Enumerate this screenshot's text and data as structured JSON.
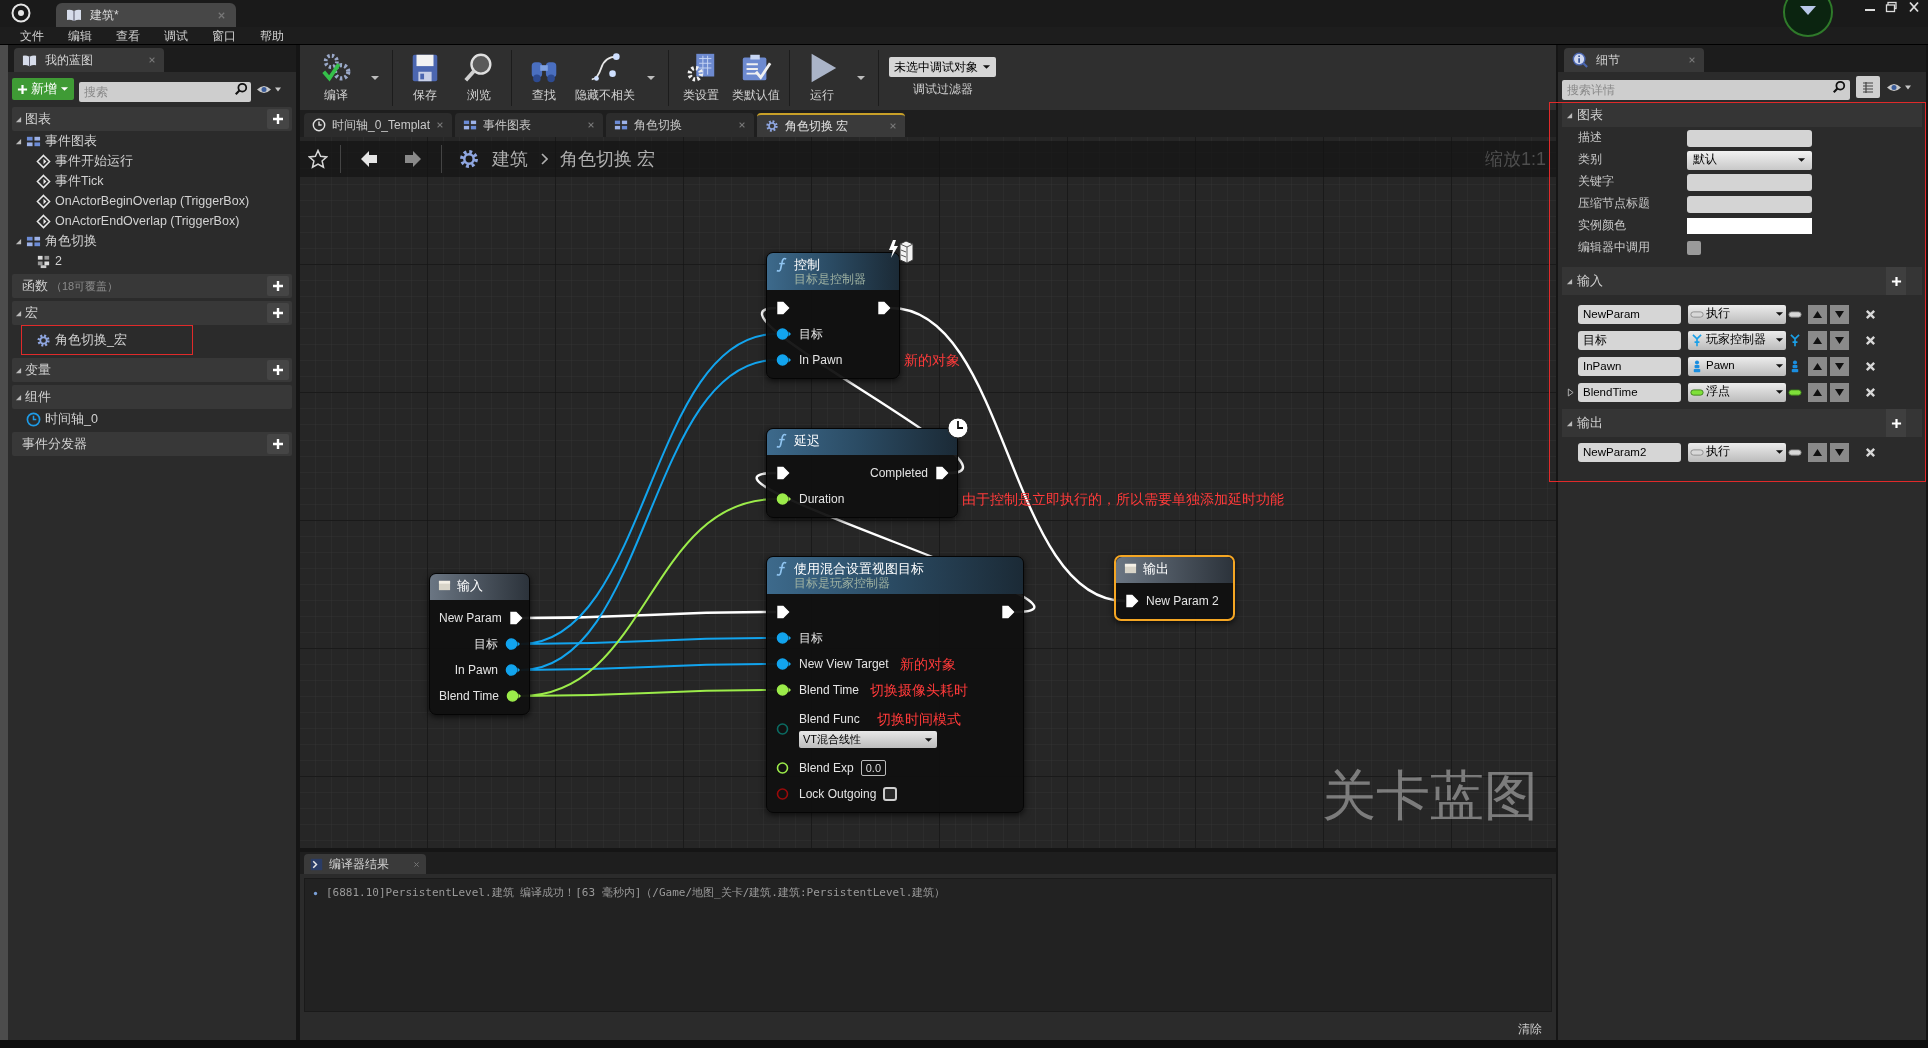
{
  "title_bar": {
    "tab": "建筑*"
  },
  "menu": [
    "文件",
    "编辑",
    "查看",
    "调试",
    "窗口",
    "帮助"
  ],
  "my_blueprint": {
    "tab": "我的蓝图",
    "add_button": "新增",
    "search": {
      "placeholder": "搜索"
    },
    "sections": [
      {
        "kind": "tree",
        "title": "图表",
        "expanded": true,
        "add": true,
        "items": [
          {
            "kind": "graph",
            "label": "事件图表",
            "expanded": true,
            "children": [
              {
                "kind": "event",
                "label": "事件开始运行"
              },
              {
                "kind": "event",
                "label": "事件Tick"
              },
              {
                "kind": "event",
                "label": "OnActorBeginOverlap (TriggerBox)"
              },
              {
                "kind": "event",
                "label": "OnActorEndOverlap (TriggerBox)"
              }
            ]
          },
          {
            "kind": "graph",
            "label": "角色切换",
            "expanded": true,
            "children": [
              {
                "kind": "node-group",
                "label": "2"
              }
            ]
          }
        ]
      },
      {
        "kind": "plain",
        "title": "函数",
        "count": "（18可覆盖）",
        "add": true
      },
      {
        "kind": "tree",
        "title": "宏",
        "expanded": true,
        "add": true,
        "items": [
          {
            "kind": "macro",
            "label": "角色切换_宏",
            "highlighted": true
          }
        ]
      },
      {
        "kind": "tree",
        "title": "变量",
        "expanded": true,
        "add": true
      },
      {
        "kind": "tree",
        "title": "组件",
        "expanded": true,
        "add": false,
        "items": [
          {
            "kind": "timeline",
            "label": "时间轴_0"
          }
        ]
      },
      {
        "kind": "plain",
        "title": "事件分发器",
        "add": true
      }
    ]
  },
  "toolbar": {
    "groups": [
      [
        {
          "kind": "compile",
          "label": "编译",
          "menu": true
        }
      ],
      [
        {
          "kind": "save",
          "label": "保存",
          "menu": false
        },
        {
          "kind": "browse",
          "label": "浏览",
          "menu": false
        }
      ],
      [
        {
          "kind": "find",
          "label": "查找",
          "menu": false
        },
        {
          "kind": "hide",
          "label": "隐藏不相关",
          "menu": true
        }
      ],
      [
        {
          "kind": "class-settings",
          "label": "类设置",
          "menu": false
        },
        {
          "kind": "class-defaults",
          "label": "类默认值",
          "menu": false
        }
      ],
      [
        {
          "kind": "run",
          "label": "运行",
          "menu": true
        }
      ]
    ],
    "debug": {
      "value": "未选中调试对象",
      "label": "调试过滤器"
    }
  },
  "document_tabs": [
    {
      "kind": "timeline",
      "label": "时间轴_0_Templat",
      "selected": false
    },
    {
      "kind": "graph",
      "label": "事件图表",
      "selected": false
    },
    {
      "kind": "graph",
      "label": "角色切换",
      "selected": false
    },
    {
      "kind": "macro",
      "label": "角色切换 宏",
      "selected": true
    }
  ],
  "graph": {
    "breadcrumb": [
      "建筑",
      "角色切换 宏"
    ],
    "zoom": "缩放1:1",
    "watermark": "关卡蓝图",
    "nodes": [
      {
        "kind": "replicated-function",
        "title": "控制",
        "subtitle": "目标是控制器",
        "selected": false,
        "rows": [
          {
            "in": {
              "kind": "exec",
              "connected": true
            },
            "out": {
              "kind": "exec",
              "connected": true
            }
          },
          {
            "in": {
              "kind": "object",
              "label": "目标",
              "connected": true
            }
          },
          {
            "in": {
              "kind": "object",
              "label": "In Pawn",
              "connected": true,
              "note": "新的对象"
            }
          }
        ]
      },
      {
        "kind": "latent-function",
        "title": "延迟",
        "selected": false,
        "rows": [
          {
            "in": {
              "kind": "exec",
              "connected": true
            },
            "out": {
              "kind": "exec",
              "label": "Completed",
              "connected": true
            }
          },
          {
            "in": {
              "kind": "float",
              "label": "Duration",
              "connected": true,
              "note": "由于控制是立即执行的，所以需要单独添加延时功能"
            }
          }
        ]
      },
      {
        "kind": "tunnel",
        "title": "输入",
        "selected": false,
        "rows": [
          {
            "out": {
              "kind": "exec",
              "label": "New Param",
              "connected": true
            }
          },
          {
            "out": {
              "kind": "object",
              "label": "目标",
              "connected": true
            }
          },
          {
            "out": {
              "kind": "object",
              "label": "In Pawn",
              "connected": true
            }
          },
          {
            "out": {
              "kind": "float",
              "label": "Blend Time",
              "connected": true
            }
          }
        ]
      },
      {
        "kind": "function",
        "title": "使用混合设置视图目标",
        "subtitle": "目标是玩家控制器",
        "selected": false,
        "rows": [
          {
            "in": {
              "kind": "exec",
              "connected": true
            },
            "out": {
              "kind": "exec",
              "connected": true
            }
          },
          {
            "in": {
              "kind": "object",
              "label": "目标",
              "connected": true
            }
          },
          {
            "in": {
              "kind": "object",
              "label": "New View Target",
              "connected": true,
              "note": "新的对象"
            }
          },
          {
            "in": {
              "kind": "float",
              "label": "Blend Time",
              "connected": true,
              "note": "切换摄像头耗时"
            }
          },
          {
            "in": {
              "kind": "enum",
              "label": "Blend Func",
              "connected": false,
              "note": "切换时间模式",
              "dropdown": "VT混合线性"
            }
          },
          {
            "in": {
              "kind": "float",
              "label": "Blend Exp",
              "connected": false,
              "value": "0.0"
            }
          },
          {
            "in": {
              "kind": "bool",
              "label": "Lock Outgoing",
              "connected": false,
              "checked": false
            }
          }
        ]
      },
      {
        "kind": "tunnel",
        "title": "输出",
        "selected": true,
        "rows": [
          {
            "in": {
              "kind": "exec",
              "label": "New Param 2",
              "connected": true
            }
          }
        ]
      }
    ]
  },
  "compiler": {
    "tab": "编译器结果",
    "messages": [
      "[6881.10]PersistentLevel.建筑 编译成功！[63 毫秒内]（/Game/地图_关卡/建筑.建筑:PersistentLevel.建筑）"
    ],
    "clear_button": "清除"
  },
  "details": {
    "tab": "细节",
    "search": {
      "placeholder": "搜索详情"
    },
    "highlighted": true,
    "graph_section": {
      "title": "图表",
      "expanded": true,
      "properties": [
        {
          "kind": "text",
          "label": "描述"
        },
        {
          "kind": "dropdown",
          "label": "类别",
          "value": "默认"
        },
        {
          "kind": "text",
          "label": "关键字"
        },
        {
          "kind": "text",
          "label": "压缩节点标题"
        },
        {
          "kind": "color",
          "label": "实例颜色",
          "color": "#ffffff"
        },
        {
          "kind": "checkbox",
          "label": "编辑器中调用",
          "checked": false
        }
      ]
    },
    "inputs": {
      "title": "输入",
      "expanded": true,
      "params": [
        {
          "name": "NewParam",
          "type": "执行",
          "kind": "exec",
          "expandable": false
        },
        {
          "name": "目标",
          "type": "玩家控制器",
          "kind": "object",
          "expandable": false
        },
        {
          "name": "InPawn",
          "type": "Pawn",
          "kind": "pawn",
          "expandable": false
        },
        {
          "name": "BlendTime",
          "type": "浮点",
          "kind": "float",
          "expandable": true
        }
      ]
    },
    "outputs": {
      "title": "输出",
      "expanded": true,
      "params": [
        {
          "name": "NewParam2",
          "type": "执行",
          "kind": "exec",
          "expandable": false
        }
      ]
    }
  }
}
